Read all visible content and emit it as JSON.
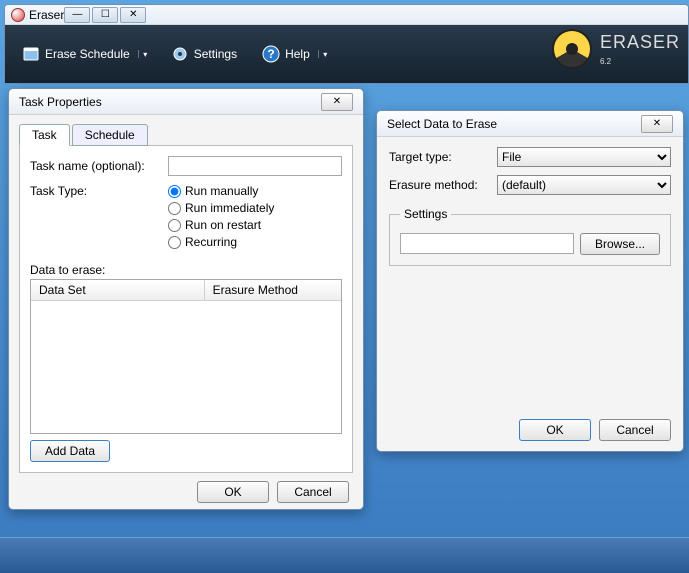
{
  "app": {
    "title": "Eraser",
    "brand": {
      "name": "ERASER",
      "version": "6.2"
    },
    "toolbar": {
      "schedule_label": "Erase Schedule",
      "settings_label": "Settings",
      "help_label": "Help"
    }
  },
  "task_dialog": {
    "title": "Task Properties",
    "tabs": {
      "task": "Task",
      "schedule": "Schedule"
    },
    "task_name_label": "Task name (optional):",
    "task_name_value": "",
    "task_type_label": "Task Type:",
    "task_type_options": {
      "manual": "Run manually",
      "immediate": "Run immediately",
      "restart": "Run on restart",
      "recurring": "Recurring"
    },
    "task_type_selected": "manual",
    "data_label": "Data to erase:",
    "columns": {
      "dataset": "Data Set",
      "method": "Erasure Method"
    },
    "add_button": "Add Data",
    "ok": "OK",
    "cancel": "Cancel"
  },
  "select_dialog": {
    "title": "Select Data to Erase",
    "target_type_label": "Target type:",
    "target_type_value": "File",
    "method_label": "Erasure method:",
    "method_value": "(default)",
    "settings_legend": "Settings",
    "path_value": "",
    "browse": "Browse...",
    "ok": "OK",
    "cancel": "Cancel"
  }
}
